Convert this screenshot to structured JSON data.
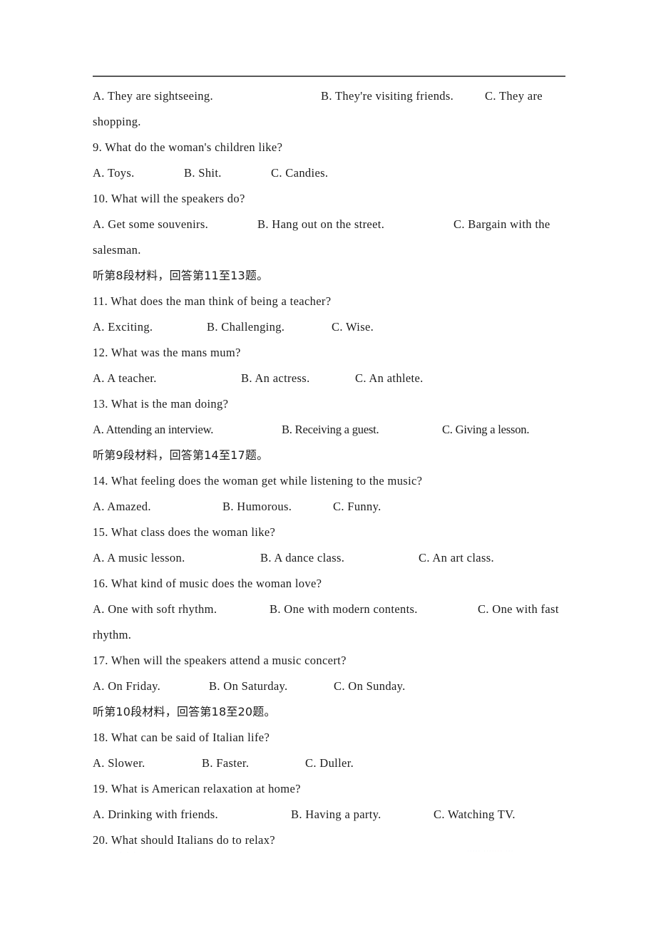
{
  "document": {
    "type": "listening-comprehension-answer-choices",
    "header_rule_color": "#585858",
    "text_color": "#1c1c1c"
  },
  "content": {
    "blocks": [
      {
        "id": "q8-options",
        "kind": "options",
        "style": "wide",
        "options": [
          "A. They are sightseeing.",
          "B. They're visiting friends.",
          "C. They are"
        ],
        "widths": [
          320,
          230,
          0
        ],
        "continuation": "shopping."
      },
      {
        "id": "q9-stem",
        "kind": "question",
        "text": "9. What do the woman's children like?"
      },
      {
        "id": "q9-options",
        "kind": "options",
        "style": "normal",
        "options": [
          "A. Toys.",
          "B. Shit.",
          "C. Candies."
        ],
        "widths": [
          128,
          122,
          0
        ]
      },
      {
        "id": "q10-stem",
        "kind": "question",
        "text": "10. What will the speakers do?"
      },
      {
        "id": "q10-options",
        "kind": "options",
        "style": "wide",
        "options": [
          "A. Get some souvenirs.",
          "B. Hang out on the street.",
          "C. Bargain with the"
        ],
        "widths": [
          231,
          275,
          0
        ],
        "continuation": "salesman."
      },
      {
        "id": "section-8-heading",
        "kind": "cn-heading",
        "text": "听第8段材料，回答第11至13题。"
      },
      {
        "id": "q11-stem",
        "kind": "question",
        "text": "11. What does the man think of being a teacher?"
      },
      {
        "id": "q11-options",
        "kind": "options",
        "style": "normal",
        "options": [
          "A. Exciting.",
          "B. Challenging.",
          "C. Wise."
        ],
        "widths": [
          160,
          175,
          0
        ]
      },
      {
        "id": "q12-stem",
        "kind": "question",
        "text": "12. What was the mans mum?"
      },
      {
        "id": "q12-options",
        "kind": "options",
        "style": "normal",
        "options": [
          "A. A teacher.",
          "B. An actress.",
          "C. An athlete."
        ],
        "widths": [
          208,
          160,
          0
        ]
      },
      {
        "id": "q13-stem",
        "kind": "question",
        "text": "13. What is the man doing?"
      },
      {
        "id": "q13-options",
        "kind": "options",
        "style": "narrow",
        "options": [
          "A. Attending an interview.",
          "B. Receiving a guest.",
          "C. Giving a lesson."
        ],
        "widths": [
          265,
          225,
          0
        ]
      },
      {
        "id": "section-9-heading",
        "kind": "cn-heading",
        "text": "听第9段材料，回答第14至17题。"
      },
      {
        "id": "q14-stem",
        "kind": "question",
        "text": "14. What feeling does the woman get while listening to the music?"
      },
      {
        "id": "q14-options",
        "kind": "options",
        "style": "normal",
        "options": [
          "A. Amazed.",
          "B. Humorous.",
          "C. Funny."
        ],
        "widths": [
          182,
          155,
          0
        ]
      },
      {
        "id": "q15-stem",
        "kind": "question",
        "text": "15. What class does the woman like?"
      },
      {
        "id": "q15-options",
        "kind": "options",
        "style": "normal",
        "options": [
          "A. A music lesson.",
          "B. A dance class.",
          "C. An art class."
        ],
        "widths": [
          235,
          222,
          0
        ]
      },
      {
        "id": "q16-stem",
        "kind": "question",
        "text": "16. What kind of music does the woman love?"
      },
      {
        "id": "q16-options",
        "kind": "options",
        "style": "wide",
        "options": [
          "A. One with soft rhythm.",
          "B. One with modern contents.",
          "C. One with fast"
        ],
        "widths": [
          248,
          292,
          0
        ],
        "continuation": "rhythm."
      },
      {
        "id": "q17-stem",
        "kind": "question",
        "text": "17. When will the speakers attend a music concert?"
      },
      {
        "id": "q17-options",
        "kind": "options",
        "style": "normal",
        "options": [
          "A. On Friday.",
          "B. On Saturday.",
          "C. On Sunday."
        ],
        "widths": [
          163,
          175,
          0
        ]
      },
      {
        "id": "section-10-heading",
        "kind": "cn-heading",
        "text": "听第10段材料，回答第18至20题。"
      },
      {
        "id": "q18-stem",
        "kind": "question",
        "text": "18. What can be said of Italian life?"
      },
      {
        "id": "q18-options",
        "kind": "options",
        "style": "normal",
        "options": [
          "A. Slower.",
          "B. Faster.",
          "C. Duller."
        ],
        "widths": [
          153,
          145,
          0
        ]
      },
      {
        "id": "q19-stem",
        "kind": "question",
        "text": "19. What is American relaxation at home?"
      },
      {
        "id": "q19-options",
        "kind": "options",
        "style": "normal",
        "options": [
          "A. Drinking with friends.",
          "B. Having a party.",
          "C. Watching TV."
        ],
        "widths": [
          278,
          200,
          0
        ]
      },
      {
        "id": "q20-stem",
        "kind": "question",
        "text": "20. What should Italians do to relax?"
      }
    ]
  },
  "watermarks": {
    "left": "· · ·",
    "right": "····· ······· ···"
  }
}
